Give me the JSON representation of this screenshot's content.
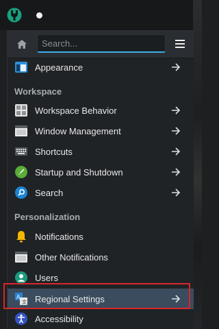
{
  "toolbar": {
    "search_placeholder": "Search..."
  },
  "items": {
    "appearance": "Appearance",
    "workspace_behavior": "Workspace Behavior",
    "window_management": "Window Management",
    "shortcuts": "Shortcuts",
    "startup_shutdown": "Startup and Shutdown",
    "search": "Search",
    "notifications": "Notifications",
    "other_notifications": "Other Notifications",
    "users": "Users",
    "regional_settings": "Regional Settings",
    "accessibility": "Accessibility"
  },
  "sections": {
    "workspace": "Workspace",
    "personalization": "Personalization"
  },
  "colors": {
    "accent": "#3daee9",
    "selected_row": "#3b4c5e",
    "annotation_box": "#d9262b"
  }
}
